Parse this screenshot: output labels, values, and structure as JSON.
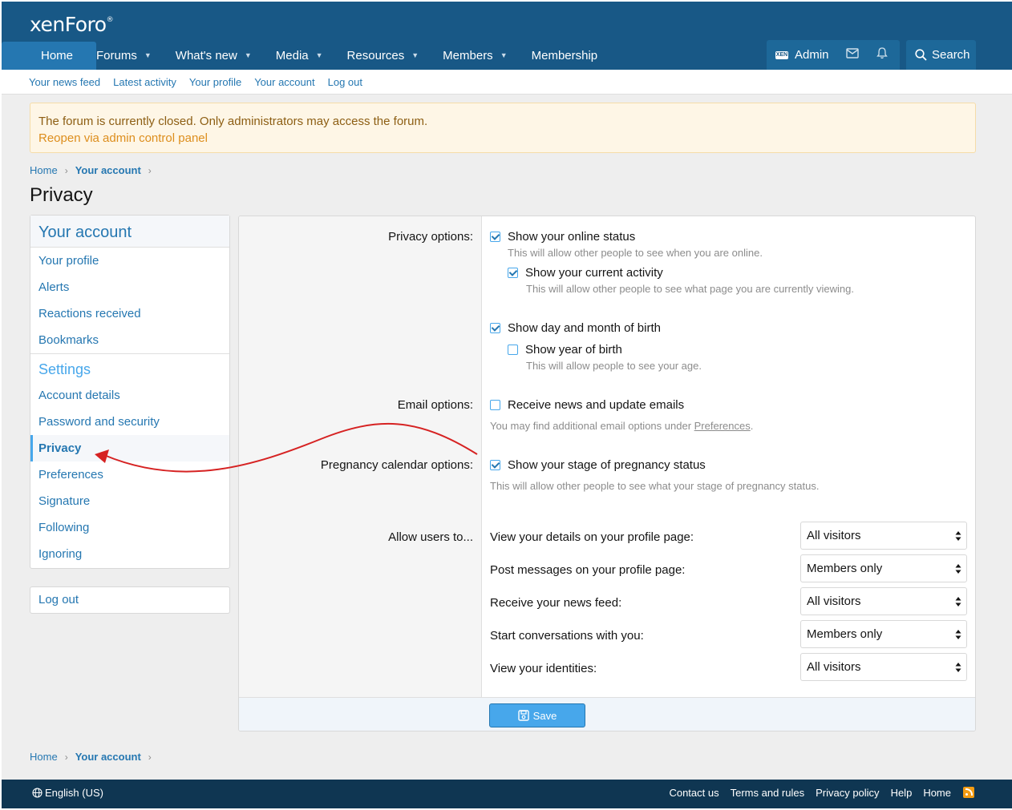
{
  "header": {
    "logo": "xenForo",
    "logo_mark": "®",
    "nav": [
      {
        "label": "Home",
        "has_caret": false
      },
      {
        "label": "Forums",
        "has_caret": true
      },
      {
        "label": "What's new",
        "has_caret": true
      },
      {
        "label": "Media",
        "has_caret": true
      },
      {
        "label": "Resources",
        "has_caret": true
      },
      {
        "label": "Members",
        "has_caret": true
      },
      {
        "label": "Membership",
        "has_caret": false
      }
    ],
    "admin_label": "Admin",
    "admin_badge": "XEN",
    "search_label": "Search"
  },
  "subnav": [
    "Your news feed",
    "Latest activity",
    "Your profile",
    "Your account",
    "Log out"
  ],
  "notice": {
    "text": "The forum is currently closed. Only administrators may access the forum.",
    "link": "Reopen via admin control panel"
  },
  "breadcrumb": {
    "home": "Home",
    "current": "Your account"
  },
  "page_title": "Privacy",
  "sidebar": {
    "heading": "Your account",
    "items": [
      "Your profile",
      "Alerts",
      "Reactions received",
      "Bookmarks"
    ],
    "settings_heading": "Settings",
    "settings_items": [
      "Account details",
      "Password and security",
      "Privacy",
      "Preferences",
      "Signature",
      "Following",
      "Ignoring"
    ],
    "active": "Privacy",
    "logout": "Log out"
  },
  "form": {
    "privacy_label": "Privacy options:",
    "online_status": {
      "label": "Show your online status",
      "checked": true,
      "hint": "This will allow other people to see when you are online."
    },
    "current_activity": {
      "label": "Show your current activity",
      "checked": true,
      "hint": "This will allow other people to see what page you are currently viewing."
    },
    "dob_day_month": {
      "label": "Show day and month of birth",
      "checked": true
    },
    "dob_year": {
      "label": "Show year of birth",
      "checked": false,
      "hint": "This will allow people to see your age."
    },
    "email_label": "Email options:",
    "receive_news": {
      "label": "Receive news and update emails",
      "checked": false
    },
    "email_hint_prefix": "You may find additional email options under ",
    "email_hint_link": "Preferences",
    "email_hint_suffix": ".",
    "pregnancy_label": "Pregnancy calendar options:",
    "pregnancy": {
      "label": "Show your stage of pregnancy status",
      "checked": true,
      "hint": "This will allow other people to see what your stage of pregnancy status."
    },
    "allow_label": "Allow users to...",
    "allow_rows": [
      {
        "label": "View your details on your profile page:",
        "value": "All visitors"
      },
      {
        "label": "Post messages on your profile page:",
        "value": "Members only"
      },
      {
        "label": "Receive your news feed:",
        "value": "All visitors"
      },
      {
        "label": "Start conversations with you:",
        "value": "Members only"
      },
      {
        "label": "View your identities:",
        "value": "All visitors"
      }
    ],
    "save_label": "Save"
  },
  "footer": {
    "language": "English (US)",
    "links": [
      "Contact us",
      "Terms and rules",
      "Privacy policy",
      "Help",
      "Home"
    ]
  },
  "colors": {
    "header": "#185886",
    "accent": "#2577b1",
    "annotation_arrow": "#d62222"
  }
}
